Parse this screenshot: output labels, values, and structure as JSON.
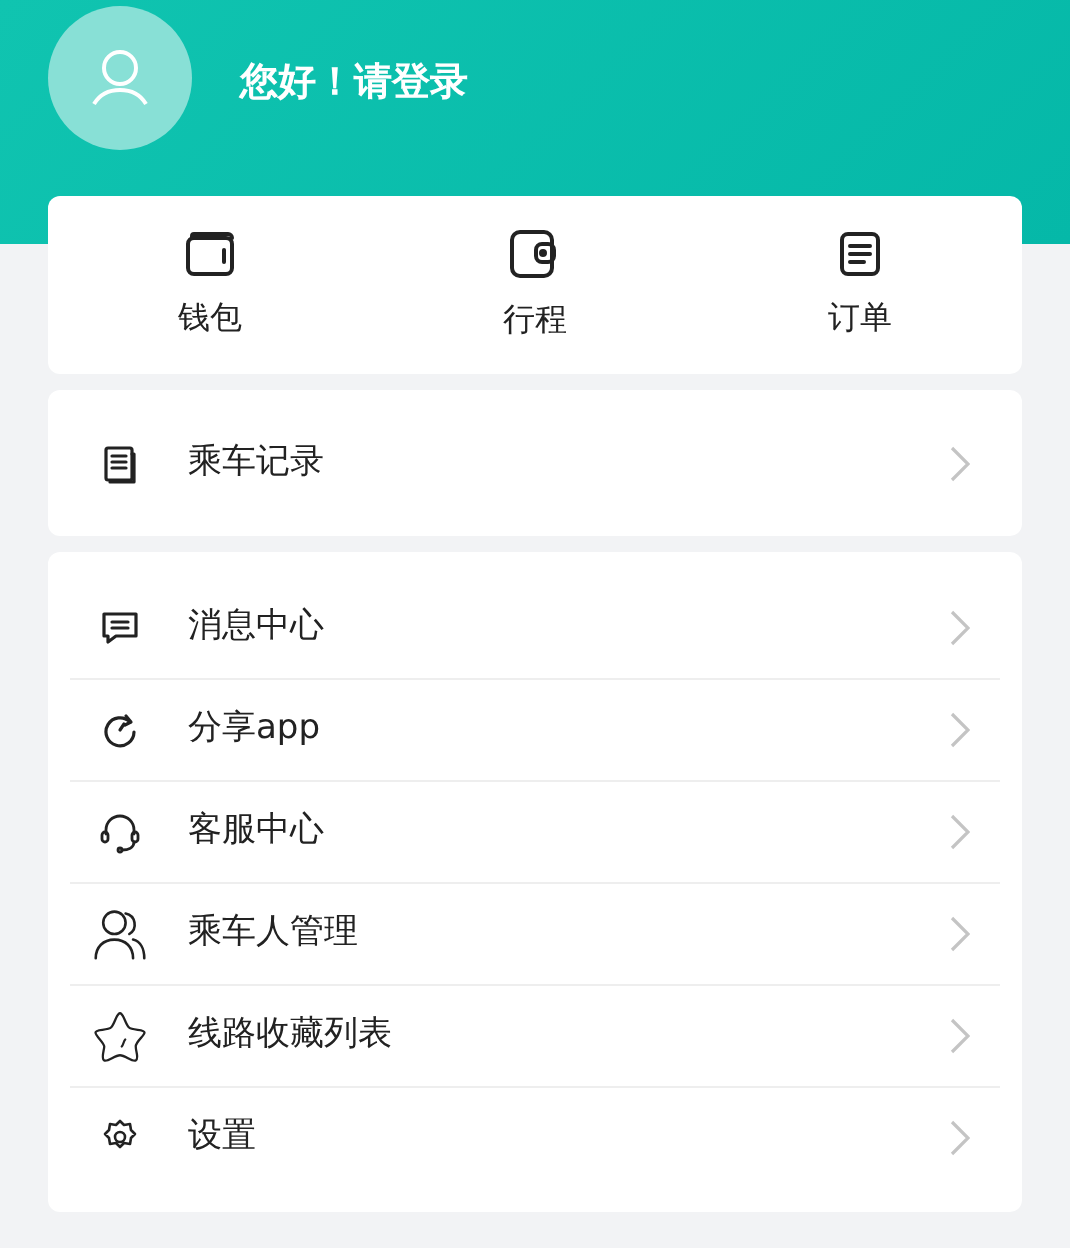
{
  "header": {
    "greeting": "您好！请登录"
  },
  "shortcuts": [
    {
      "kind": "wallet",
      "label": "钱包"
    },
    {
      "kind": "trip",
      "label": "行程"
    },
    {
      "kind": "order",
      "label": "订单"
    }
  ],
  "records": [
    {
      "kind": "record",
      "label": "乘车记录"
    }
  ],
  "menu": [
    {
      "kind": "message",
      "label": "消息中心"
    },
    {
      "kind": "share",
      "label": "分享app"
    },
    {
      "kind": "service",
      "label": "客服中心"
    },
    {
      "kind": "people",
      "label": "乘车人管理"
    },
    {
      "kind": "star",
      "label": "线路收藏列表"
    },
    {
      "kind": "settings",
      "label": "设置"
    }
  ]
}
